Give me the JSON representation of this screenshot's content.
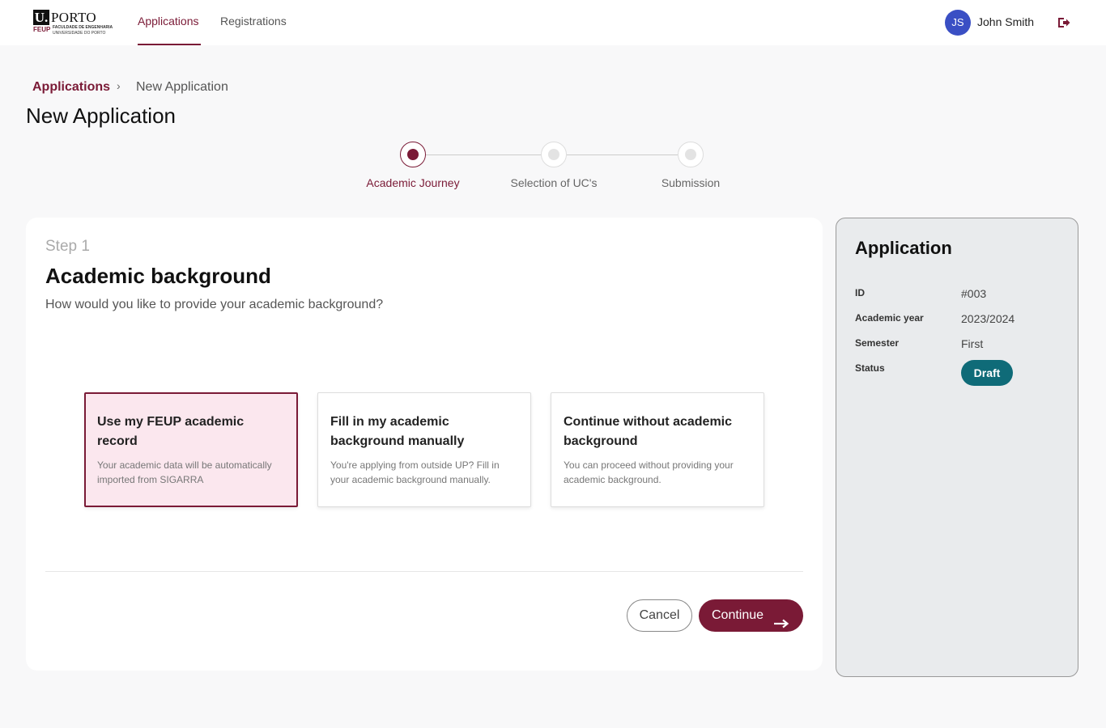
{
  "header": {
    "logo": {
      "up": "U.",
      "porto": "PORTO",
      "feup": "FEUP",
      "faculty": "FACULDADE DE ENGENHARIA",
      "university": "UNIVERSIDADE DO PORTO"
    },
    "tabs": [
      {
        "label": "Applications",
        "active": true
      },
      {
        "label": "Registrations",
        "active": false
      }
    ],
    "user": {
      "initials": "JS",
      "name": "John Smith"
    },
    "logout_icon": "logout-icon"
  },
  "breadcrumb": {
    "link": "Applications",
    "separator": "›",
    "current": "New Application"
  },
  "page_title": "New Application",
  "stepper": {
    "steps": [
      {
        "label": "Academic Journey",
        "active": true
      },
      {
        "label": "Selection of UC's",
        "active": false
      },
      {
        "label": "Submission",
        "active": false
      }
    ]
  },
  "main": {
    "step_number": "Step 1",
    "title": "Academic background",
    "question": "How would you like to provide your academic background?",
    "options": [
      {
        "title": "Use my FEUP academic record",
        "description": "Your academic data will be automatically imported from SIGARRA",
        "selected": true
      },
      {
        "title": "Fill in my academic background manually",
        "description": "You're applying from outside UP? Fill in your academic background manually.",
        "selected": false
      },
      {
        "title": "Continue without academic background",
        "description": "You can proceed without providing your academic background.",
        "selected": false
      }
    ],
    "cancel_label": "Cancel",
    "continue_label": "Continue"
  },
  "side_panel": {
    "title": "Application",
    "fields": [
      {
        "label": "ID",
        "value": "#003"
      },
      {
        "label": "Academic year",
        "value": "2023/2024"
      },
      {
        "label": "Semester",
        "value": "First"
      },
      {
        "label": "Status",
        "value": "Draft"
      }
    ]
  },
  "colors": {
    "brand": "#7a1a36",
    "avatar": "#3a4fc4",
    "status_draft": "#0f6b78",
    "selected_bg": "#fbe7ee"
  }
}
